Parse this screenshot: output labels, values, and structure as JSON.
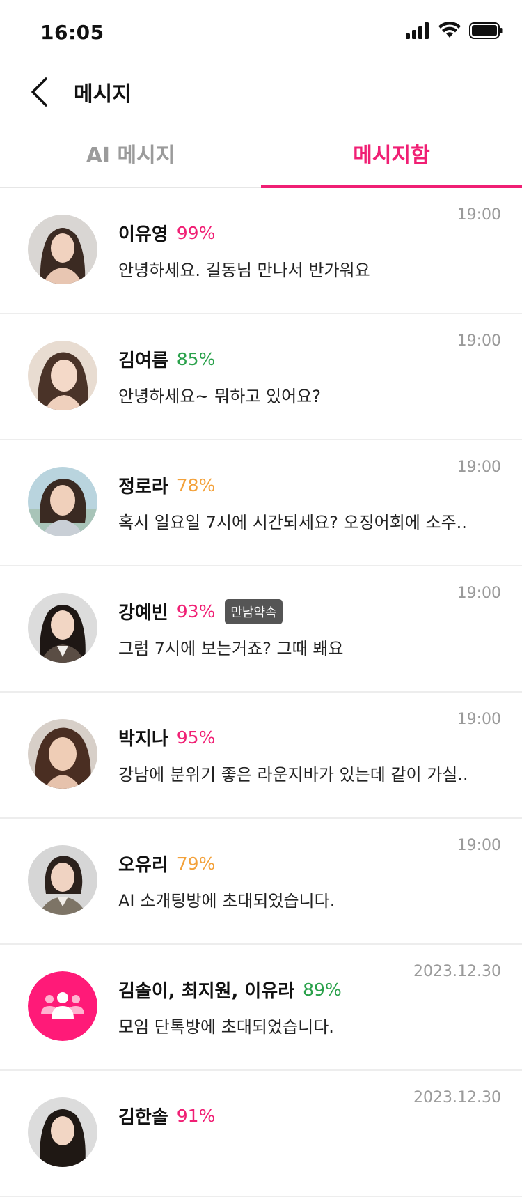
{
  "status_bar": {
    "time": "16:05",
    "icons": [
      "signal-icon",
      "wifi-icon",
      "battery-icon"
    ]
  },
  "header": {
    "back_icon": "chevron-left-icon",
    "title": "메시지"
  },
  "tabs": [
    {
      "label": "AI 메시지",
      "active": false
    },
    {
      "label": "메시지함",
      "active": true
    }
  ],
  "colors": {
    "accent": "#f01f74",
    "pink_percent": "#f01f74",
    "green_percent": "#2aa14b",
    "orange_percent": "#f3a13a",
    "group_avatar": "#ff1a78"
  },
  "conversations": [
    {
      "name": "이유영",
      "percent": "99%",
      "percent_color": "#f01f74",
      "preview": "안녕하세요. 길동님 만나서 반가워요",
      "time": "19:00",
      "badge": ""
    },
    {
      "name": "김여름",
      "percent": "85%",
      "percent_color": "#2aa14b",
      "preview": "안녕하세요~ 뭐하고 있어요?",
      "time": "19:00",
      "badge": ""
    },
    {
      "name": "정로라",
      "percent": "78%",
      "percent_color": "#f3a13a",
      "preview": "혹시 일요일 7시에 시간되세요? 오징어회에 소주..",
      "time": "19:00",
      "badge": ""
    },
    {
      "name": "강예빈",
      "percent": "93%",
      "percent_color": "#f01f74",
      "preview": "그럼 7시에 보는거죠? 그때 봬요",
      "time": "19:00",
      "badge": "만남약속"
    },
    {
      "name": "박지나",
      "percent": "95%",
      "percent_color": "#f01f74",
      "preview": "강남에 분위기 좋은 라운지바가 있는데 같이 가실..",
      "time": "19:00",
      "badge": ""
    },
    {
      "name": "오유리",
      "percent": "79%",
      "percent_color": "#f3a13a",
      "preview": "AI 소개팅방에 초대되었습니다.",
      "time": "19:00",
      "badge": ""
    },
    {
      "name": "김솔이, 최지원, 이유라",
      "percent": "89%",
      "percent_color": "#2aa14b",
      "preview": "모임 단톡방에 초대되었습니다.",
      "time": "2023.12.30",
      "badge": "",
      "group": true
    },
    {
      "name": "김한솔",
      "percent": "91%",
      "percent_color": "#f01f74",
      "preview": "",
      "time": "2023.12.30",
      "badge": ""
    }
  ]
}
